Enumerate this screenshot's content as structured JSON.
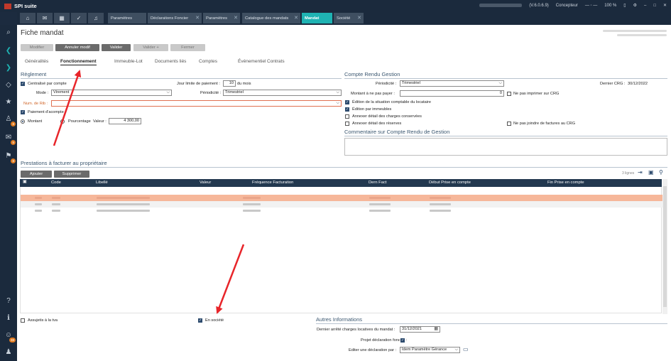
{
  "app": {
    "title": "SPI suite",
    "version": "(V.6.0.6.9)",
    "user": "Concepteur",
    "zoom": "100 %"
  },
  "tabs": [
    {
      "label": "Paramètres"
    },
    {
      "label": "Déclarations Foncier"
    },
    {
      "label": "Paramètres"
    },
    {
      "label": "Catalogue des mandats"
    },
    {
      "label": "Mandat"
    },
    {
      "label": "Société"
    }
  ],
  "page": {
    "title": "Fiche mandat"
  },
  "toolbar": {
    "modifier": "Modifier",
    "annuler": "Annuler modif",
    "valider": "Valider",
    "valider_plus": "Valider +",
    "fermer": "Fermer"
  },
  "subtabs": {
    "generalites": "Généralités",
    "fonctionnement": "Fonctionnement",
    "immeuble": "Immeuble-Lot",
    "documents": "Documents liés",
    "comptes": "Comptes",
    "evenementiel": "Événementiel",
    "contrats": "Contrats"
  },
  "reglement": {
    "title": "Règlement",
    "centralise": "Centralisé par compte",
    "jour_limite_label": "Jour limite de paiement :",
    "jour_limite_value": "10",
    "du_mois": "du mois",
    "mode_label": "Mode :",
    "mode_value": "Virement",
    "periodicite_label": "Périodicité :",
    "periodicite_value": "Trimestriel",
    "rib_label": "Num. de Rib :",
    "paiement_acompte": "Paiement d'acompte",
    "montant": "Montant",
    "pourcentage": "Pourcentage",
    "valeur_label": "Valeur :",
    "valeur_value": "4 300,00"
  },
  "crg": {
    "title": "Compte Rendu Gestion",
    "periodicite_label": "Périodicité :",
    "periodicite_value": "Trimestriel",
    "dernier_crg_label": "Dernier CRG :",
    "dernier_crg_value": "30/12/2022",
    "montant_label": "Montant à ne pas payer :",
    "montant_value": "0",
    "ne_pas_imprimer": "Ne pas imprimer sur CRG",
    "edition_situation": "Édition de la situation comptable du locataire",
    "edition_immeubles": "Édition par immeubles",
    "annexer_charges": "Annexer détail des charges conservées",
    "annexer_reserves": "Annexer détail des réserves",
    "ne_pas_joindre": "Ne pas joindre de factures au CRG",
    "commentaire_title": "Commentaire sur Compte Rendu de Gestion"
  },
  "prestations": {
    "title": "Prestations à facturer au propriétaire",
    "ajouter": "Ajouter",
    "supprimer": "Supprimer",
    "count": "3 lignes",
    "columns": [
      "Code",
      "Libellé",
      "Valeur",
      "Fréquence Facturation",
      "Dern Fact",
      "Début Prise en compte",
      "Fin Prise en compte"
    ]
  },
  "footer": {
    "assujetti": "Assujetis à la tva",
    "en_societe": "En société",
    "autres_title": "Autres Informations",
    "dernier_arrete_label": "Dernier arrêté charges locatives du mandat :",
    "dernier_arrete_value": "31/12/2021",
    "projet_label": "Projet déclaration foncier :",
    "editer_label": "Editer une déclaration par :",
    "editer_value": "Idem Paramètre Gérance"
  },
  "icons": [
    "search-icon",
    "home-icon",
    "mail-icon",
    "calendar-icon",
    "check-icon",
    "bell-icon",
    "star-icon",
    "help-icon",
    "user-icon",
    "filter-icon",
    "export-icon",
    "calendar-picker-icon",
    "monitor-icon"
  ],
  "colors": {
    "accent_tab": "#1fb3b3",
    "navy": "#1b2a3d",
    "grid_header": "#22384f",
    "selected_row": "#f6b79a",
    "arrow": "#e8252a"
  }
}
